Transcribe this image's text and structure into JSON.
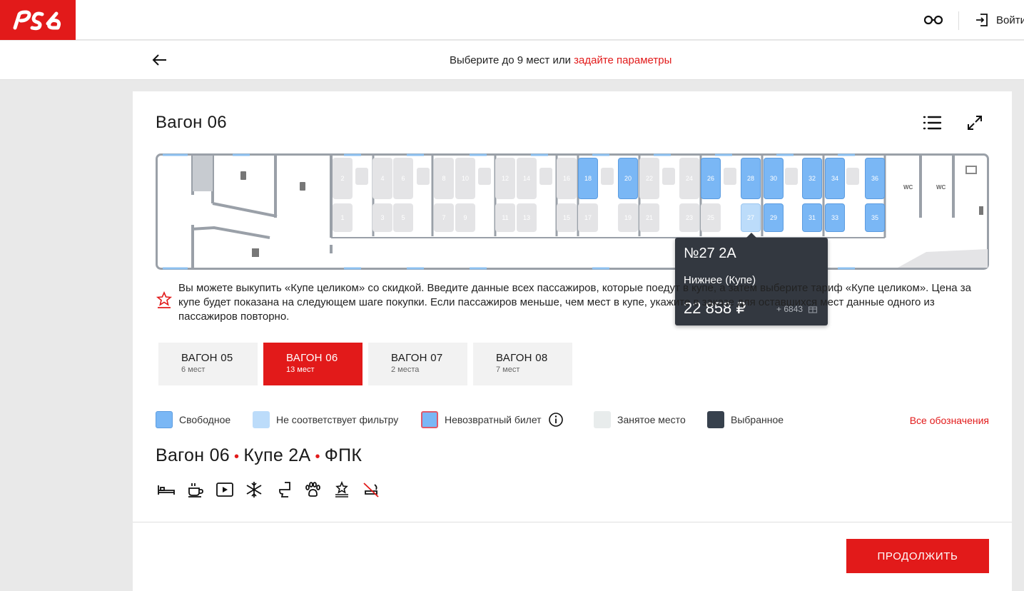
{
  "header": {
    "brand": "РЖД",
    "login_label": "Войти"
  },
  "subheader": {
    "text": "Выберите до 9 мест  или",
    "link": "задайте параметры"
  },
  "car": {
    "title": "Вагон 06"
  },
  "scheme": {
    "seats": [
      {
        "n": "1",
        "s": "occupied"
      },
      {
        "n": "2",
        "s": "occupied"
      },
      {
        "n": "3",
        "s": "occupied"
      },
      {
        "n": "4",
        "s": "occupied"
      },
      {
        "n": "5",
        "s": "occupied"
      },
      {
        "n": "6",
        "s": "occupied"
      },
      {
        "n": "7",
        "s": "occupied"
      },
      {
        "n": "8",
        "s": "occupied"
      },
      {
        "n": "9",
        "s": "occupied"
      },
      {
        "n": "10",
        "s": "occupied"
      },
      {
        "n": "11",
        "s": "occupied"
      },
      {
        "n": "12",
        "s": "occupied"
      },
      {
        "n": "13",
        "s": "occupied"
      },
      {
        "n": "14",
        "s": "occupied"
      },
      {
        "n": "15",
        "s": "occupied"
      },
      {
        "n": "16",
        "s": "occupied"
      },
      {
        "n": "17",
        "s": "occupied"
      },
      {
        "n": "18",
        "s": "free"
      },
      {
        "n": "19",
        "s": "occupied"
      },
      {
        "n": "20",
        "s": "free"
      },
      {
        "n": "21",
        "s": "occupied"
      },
      {
        "n": "22",
        "s": "occupied"
      },
      {
        "n": "23",
        "s": "occupied"
      },
      {
        "n": "24",
        "s": "occupied"
      },
      {
        "n": "25",
        "s": "occupied"
      },
      {
        "n": "26",
        "s": "free"
      },
      {
        "n": "27",
        "s": "nofilter"
      },
      {
        "n": "28",
        "s": "free"
      },
      {
        "n": "29",
        "s": "free"
      },
      {
        "n": "30",
        "s": "free"
      },
      {
        "n": "31",
        "s": "free"
      },
      {
        "n": "32",
        "s": "free"
      },
      {
        "n": "33",
        "s": "free"
      },
      {
        "n": "34",
        "s": "free"
      },
      {
        "n": "35",
        "s": "free"
      },
      {
        "n": "36",
        "s": "free"
      }
    ],
    "wc_label": "WC"
  },
  "tooltip": {
    "seat": "№27 2А",
    "type": "Нижнее (Купе)",
    "price": "22 858 ₽",
    "bonus": "+ 6843"
  },
  "notice": {
    "text": "Вы можете выкупить «Купе целиком» со скидкой. Введите данные всех пассажиров, которые поедут в купе, а затем выберите тариф «Купе целиком». Цена за купе будет показана на следующем шаге покупки. Если пассажиров меньше, чем мест в купе, укажите в заказе для оставшихся мест данные одного из пассажиров повторно."
  },
  "tabs": [
    {
      "name": "ВАГОН 05",
      "count": "6 мест",
      "active": false
    },
    {
      "name": "ВАГОН 06",
      "count": "13 мест",
      "active": true
    },
    {
      "name": "ВАГОН 07",
      "count": "2 места",
      "active": false
    },
    {
      "name": "ВАГОН 08",
      "count": "7 мест",
      "active": false
    }
  ],
  "legend": {
    "items": [
      {
        "label": "Свободное",
        "color": "#7ab7f5"
      },
      {
        "label": "Не соответствует фильтру",
        "color": "#bcdcfa"
      },
      {
        "label": "Невозвратный билет",
        "color": "#7ab7f5"
      },
      {
        "label": "Занятое место",
        "color": "#e8ecec"
      },
      {
        "label": "Выбранное",
        "color": "#37414d"
      }
    ],
    "all_link": "Все обозначения"
  },
  "car_info": {
    "car": "Вагон 06",
    "class": "Купе 2А",
    "carrier": "ФПК"
  },
  "amenities": [
    "bed-icon",
    "coffee-icon",
    "video-icon",
    "air-conditioning-icon",
    "toilet-icon",
    "pets-icon",
    "premium-icon",
    "no-smoking-icon"
  ],
  "actions": {
    "continue": "ПРОДОЛЖИТЬ"
  },
  "colors": {
    "brand": "#e21a1a",
    "free": "#7ab7f5",
    "nofilter": "#bcdcfa",
    "occupied": "#e4e4e6",
    "tooltip": "#333840"
  }
}
